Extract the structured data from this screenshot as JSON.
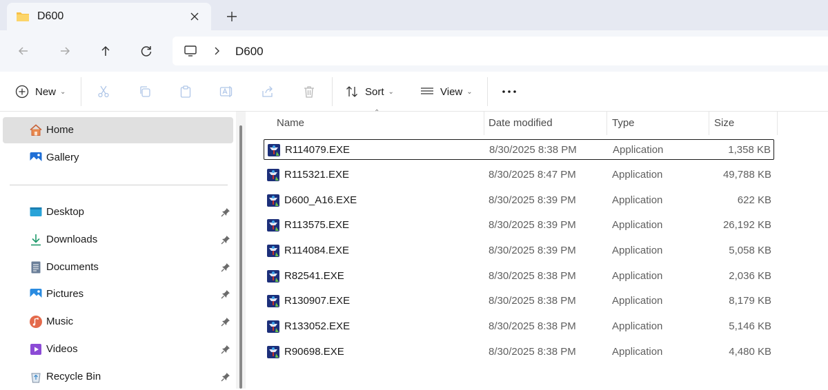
{
  "window": {
    "tab_title": "D600",
    "tab_icon": "folder-icon"
  },
  "address_bar": {
    "crumbs": [
      "D600"
    ]
  },
  "toolbar": {
    "new_label": "New",
    "sort_label": "Sort",
    "view_label": "View"
  },
  "sidebar": {
    "items": [
      {
        "label": "Home",
        "icon": "home-icon",
        "active": true
      },
      {
        "label": "Gallery",
        "icon": "gallery-icon"
      },
      {
        "label": "Desktop",
        "icon": "desktop-icon",
        "pinned": true
      },
      {
        "label": "Downloads",
        "icon": "downloads-icon",
        "pinned": true
      },
      {
        "label": "Documents",
        "icon": "documents-icon",
        "pinned": true
      },
      {
        "label": "Pictures",
        "icon": "pictures-icon",
        "pinned": true
      },
      {
        "label": "Music",
        "icon": "music-icon",
        "pinned": true
      },
      {
        "label": "Videos",
        "icon": "videos-icon",
        "pinned": true
      },
      {
        "label": "Recycle Bin",
        "icon": "recycle-bin-icon",
        "pinned": true
      }
    ]
  },
  "file_list": {
    "columns": {
      "name": "Name",
      "date": "Date modified",
      "type": "Type",
      "size": "Size"
    },
    "rows": [
      {
        "name": "R114079.EXE",
        "date": "8/30/2025 8:38 PM",
        "type": "Application",
        "size": "1,358 KB",
        "selected": true
      },
      {
        "name": "R115321.EXE",
        "date": "8/30/2025 8:47 PM",
        "type": "Application",
        "size": "49,788 KB"
      },
      {
        "name": "D600_A16.EXE",
        "date": "8/30/2025 8:39 PM",
        "type": "Application",
        "size": "622 KB"
      },
      {
        "name": "R113575.EXE",
        "date": "8/30/2025 8:39 PM",
        "type": "Application",
        "size": "26,192 KB"
      },
      {
        "name": "R114084.EXE",
        "date": "8/30/2025 8:39 PM",
        "type": "Application",
        "size": "5,058 KB"
      },
      {
        "name": "R82541.EXE",
        "date": "8/30/2025 8:38 PM",
        "type": "Application",
        "size": "2,036 KB"
      },
      {
        "name": "R130907.EXE",
        "date": "8/30/2025 8:38 PM",
        "type": "Application",
        "size": "8,179 KB"
      },
      {
        "name": "R133052.EXE",
        "date": "8/30/2025 8:38 PM",
        "type": "Application",
        "size": "5,146 KB"
      },
      {
        "name": "R90698.EXE",
        "date": "8/30/2025 8:38 PM",
        "type": "Application",
        "size": "4,480 KB"
      }
    ]
  }
}
